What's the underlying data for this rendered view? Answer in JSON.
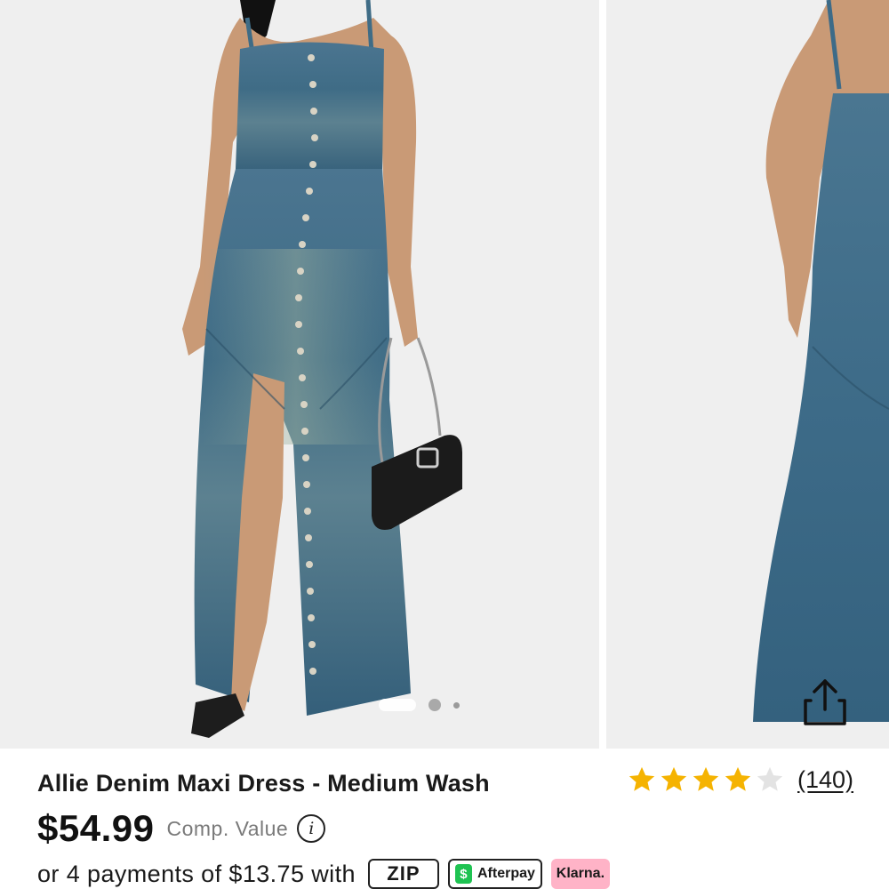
{
  "product": {
    "title": "Allie Denim Maxi Dress - Medium Wash",
    "price": "$54.99",
    "comp_value_label": "Comp. Value",
    "info_icon_glyph": "i",
    "rating": 4,
    "rating_max": 5,
    "review_count": "(140)"
  },
  "payments": {
    "text": "or 4 payments of $13.75 with",
    "providers": [
      {
        "name": "zip",
        "label": "ZIP",
        "icon": "zip-logo"
      },
      {
        "name": "afterpay",
        "label": "Afterpay",
        "icon": "afterpay-logo",
        "logo_glyph": "$"
      },
      {
        "name": "klarna",
        "label": "Klarna.",
        "icon": "klarna-logo"
      }
    ]
  },
  "gallery": {
    "slide_count": 3,
    "active_slide": 1,
    "images": [
      {
        "name": "model-front-photo"
      },
      {
        "name": "model-back-photo"
      }
    ]
  },
  "colors": {
    "star_filled": "#f5b301",
    "star_empty": "#e3e3e3",
    "denim": "#3e6a85",
    "afterpay_green": "#1fc352",
    "klarna_pink": "#ffb3c7"
  }
}
